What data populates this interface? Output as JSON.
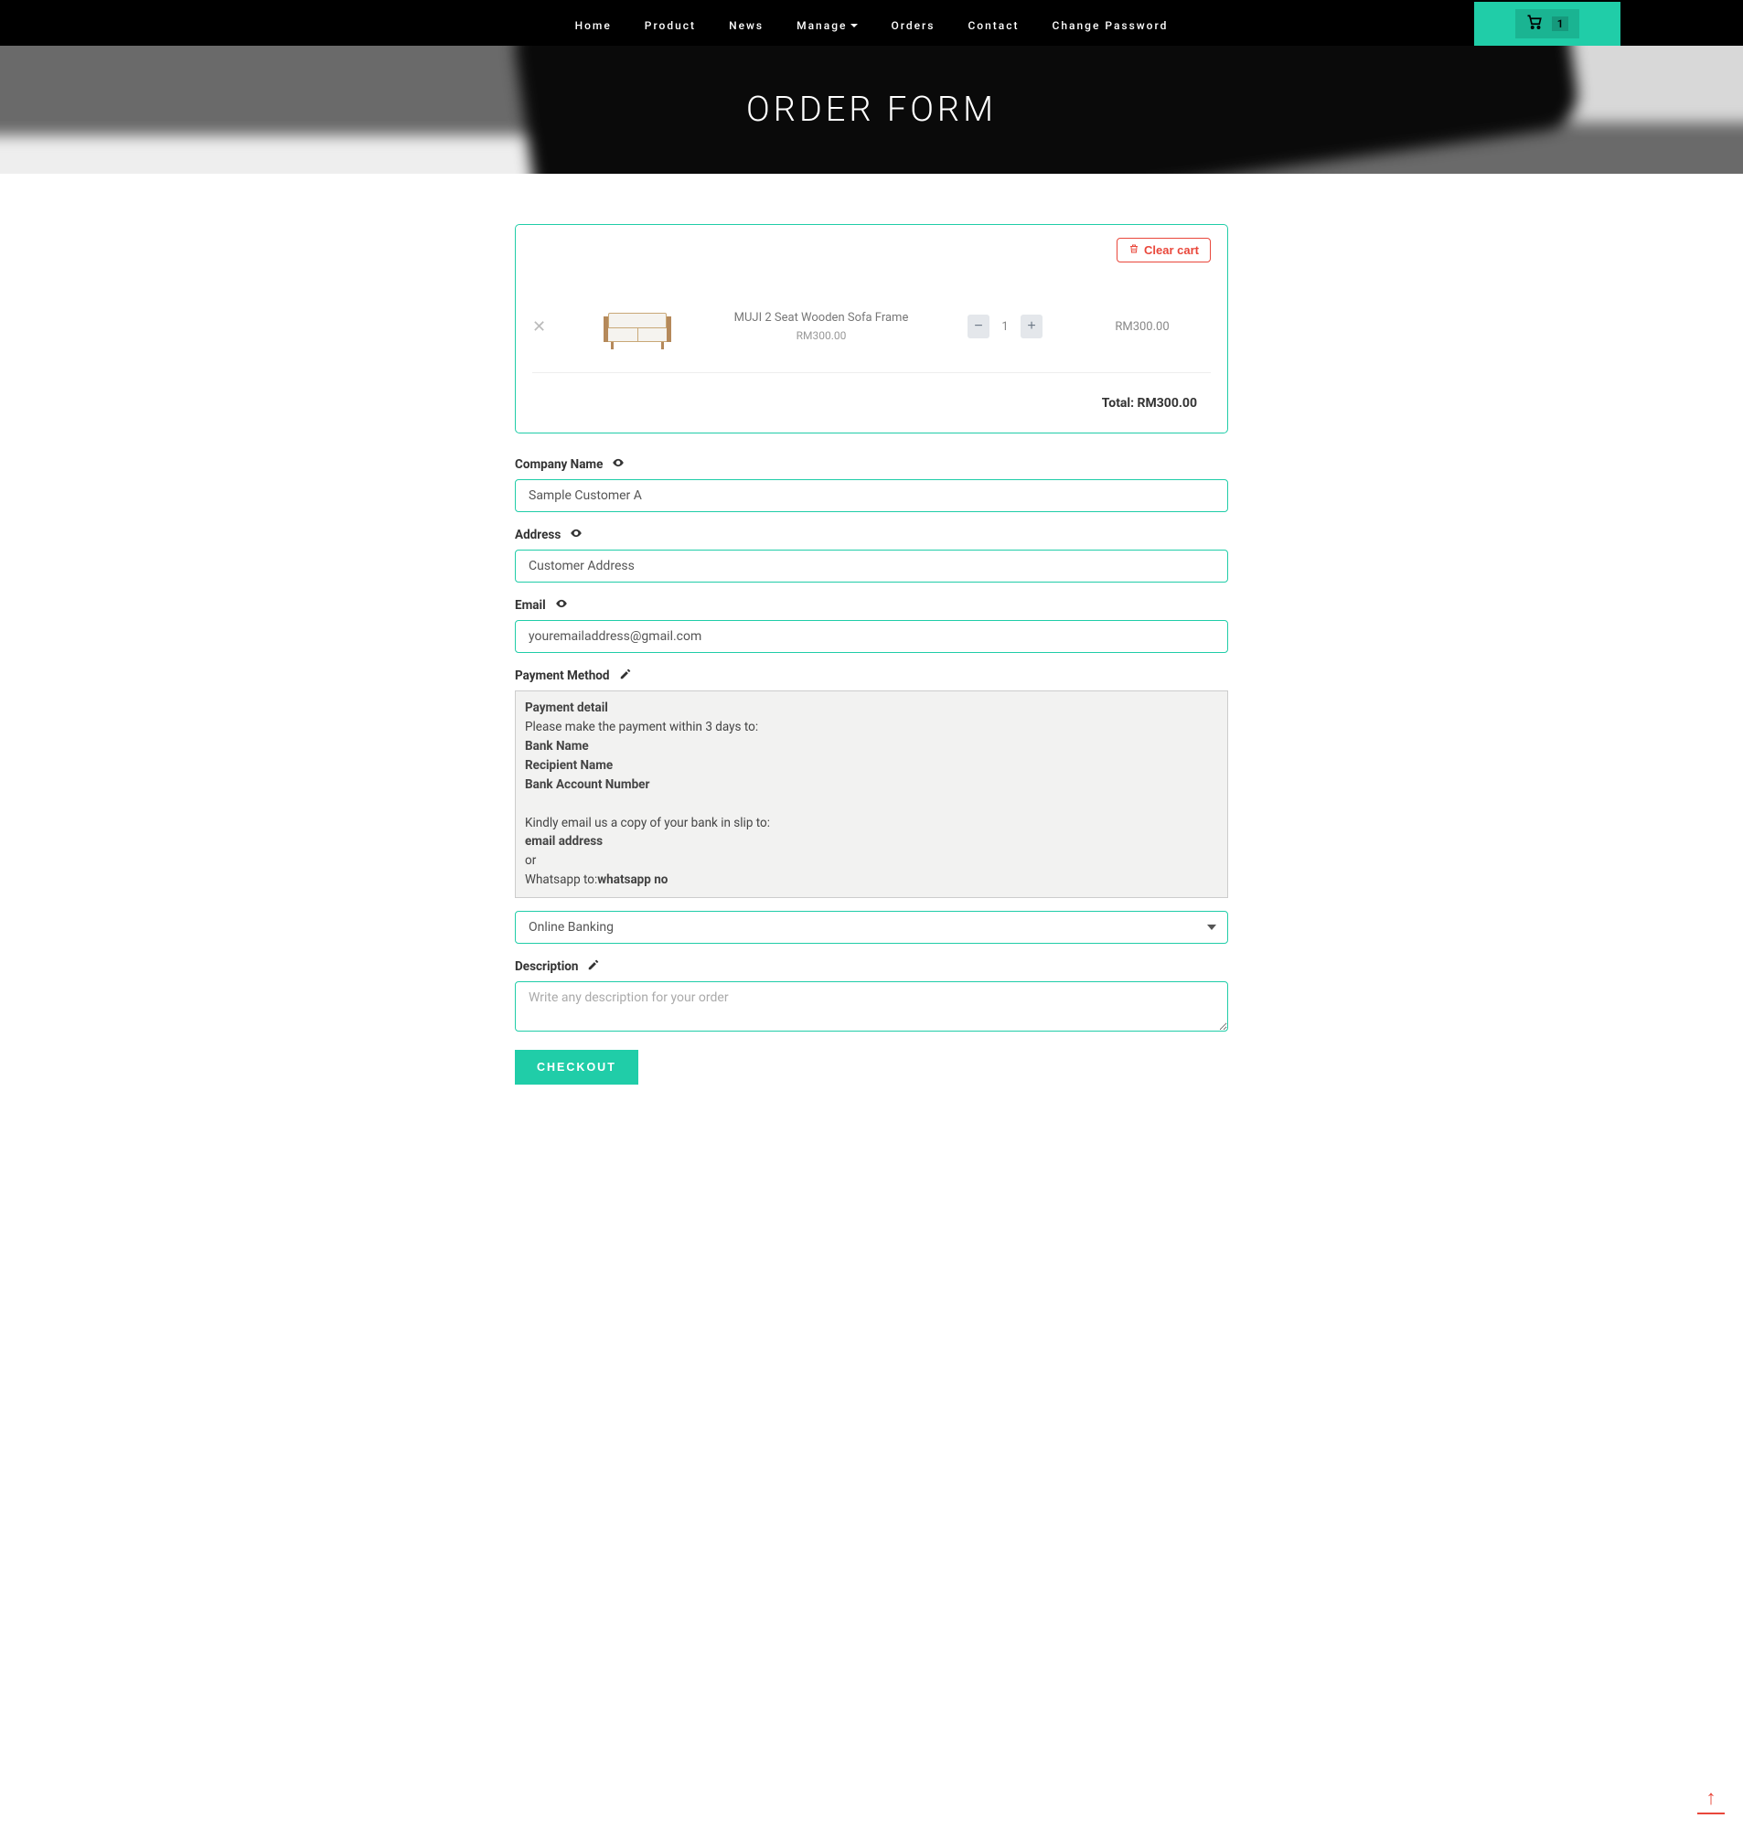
{
  "nav": {
    "items": [
      "Home",
      "Product",
      "News",
      "Manage",
      "Orders",
      "Contact",
      "Change Password"
    ],
    "cart_count": "1"
  },
  "hero": {
    "title": "ORDER FORM"
  },
  "cart": {
    "clear_label": "Clear cart",
    "item": {
      "name": "MUJI 2 Seat Wooden Sofa Frame",
      "price": "RM300.00",
      "qty": "1",
      "line_total": "RM300.00"
    },
    "total_label": "Total: RM300.00"
  },
  "form": {
    "company": {
      "label": "Company Name",
      "value": "Sample Customer A"
    },
    "address": {
      "label": "Address",
      "value": "Customer Address"
    },
    "email": {
      "label": "Email",
      "value": "youremailaddress@gmail.com"
    },
    "payment": {
      "label": "Payment Method",
      "detail": {
        "h": "Payment detail",
        "l1": "Please make the payment within 3 days to:",
        "b1": "Bank Name",
        "b2": "Recipient Name",
        "b3": "Bank Account Number",
        "l2": "Kindly email us a copy of your bank in slip to:",
        "b4": "email address",
        "l3": "or",
        "l4a": "Whatsapp to:",
        "l4b": "whatsapp no"
      },
      "selected": "Online Banking"
    },
    "description": {
      "label": "Description",
      "placeholder": "Write any description for your order"
    },
    "checkout_label": "CHECKOUT"
  }
}
